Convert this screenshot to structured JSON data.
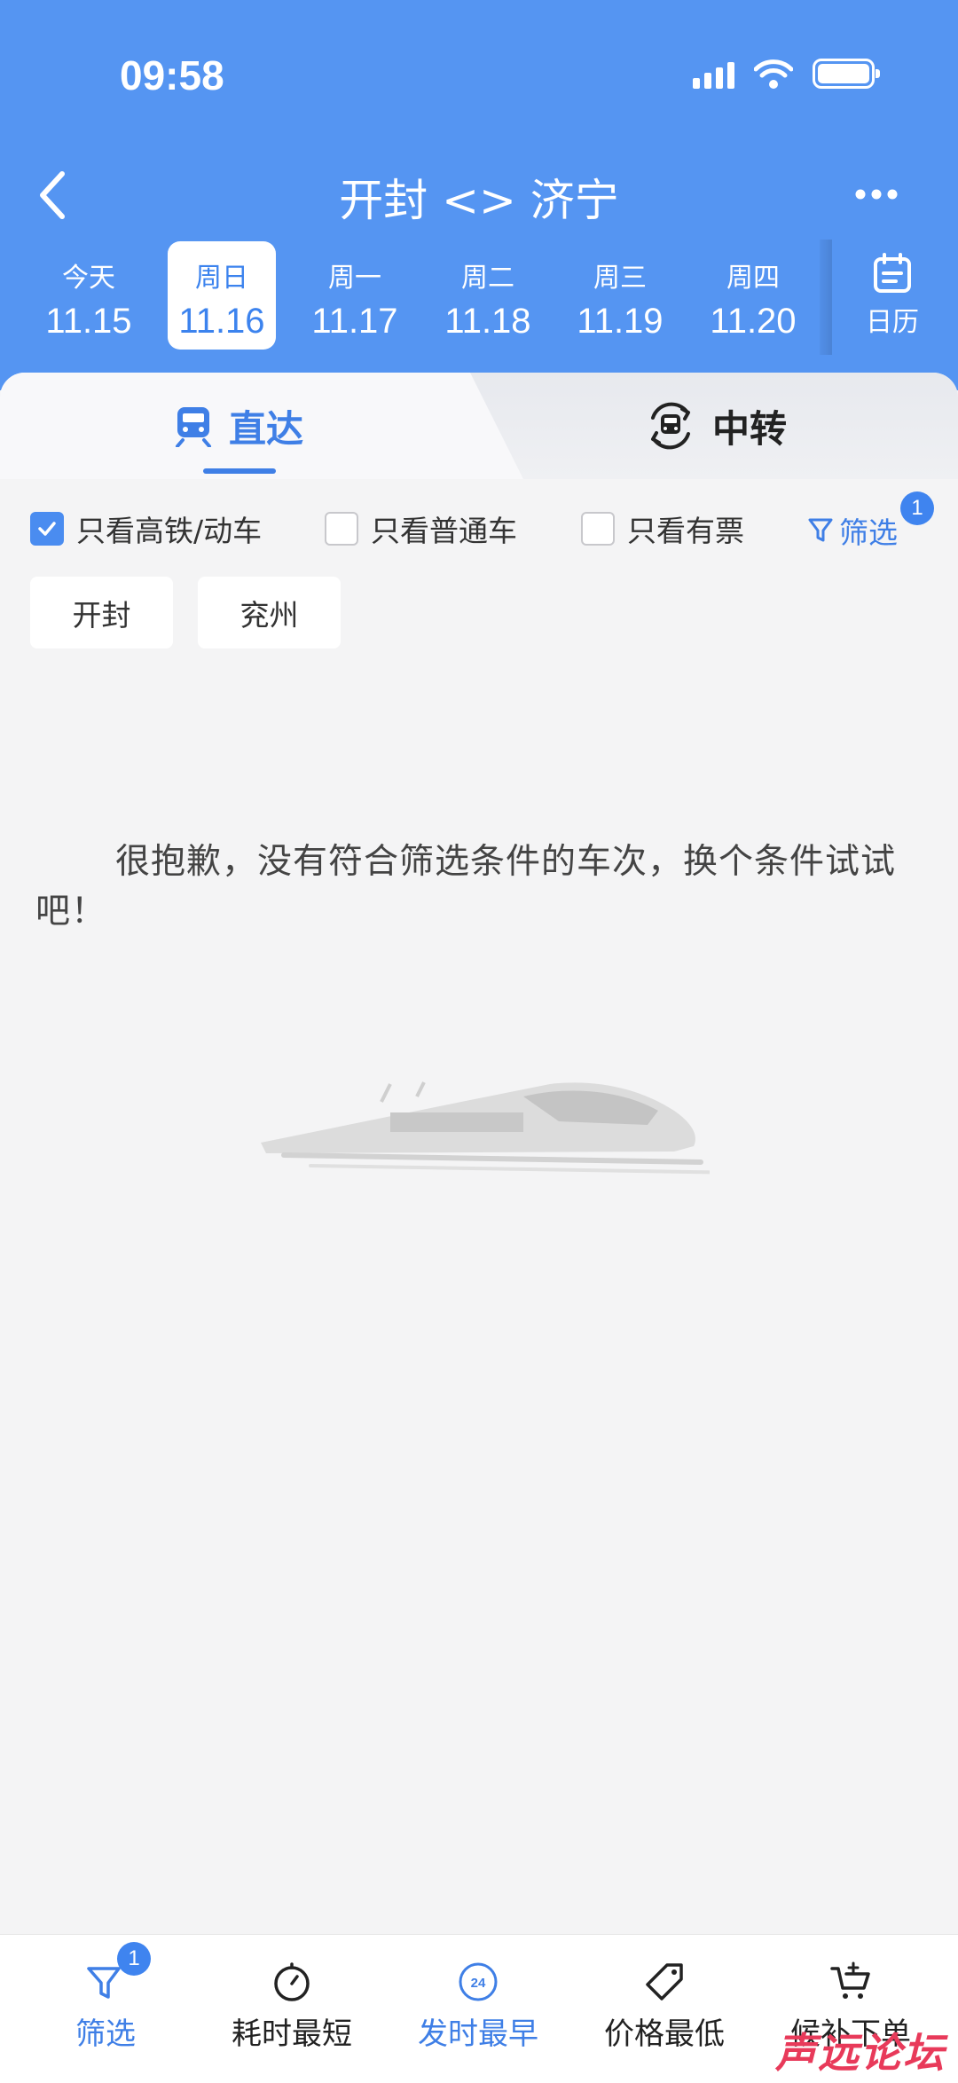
{
  "status_bar": {
    "time": "09:58"
  },
  "nav": {
    "title": "开封 <> 济宁"
  },
  "dates": [
    {
      "weekday": "今天",
      "date": "11.15"
    },
    {
      "weekday": "周日",
      "date": "11.16",
      "active": true
    },
    {
      "weekday": "周一",
      "date": "11.17"
    },
    {
      "weekday": "周二",
      "date": "11.18"
    },
    {
      "weekday": "周三",
      "date": "11.19"
    },
    {
      "weekday": "周四",
      "date": "11.20"
    }
  ],
  "calendar": {
    "label": "日历"
  },
  "tabs": {
    "direct": "直达",
    "transfer": "中转"
  },
  "filters": {
    "high_speed": {
      "label": "只看高铁/动车",
      "checked": true
    },
    "normal": {
      "label": "只看普通车",
      "checked": false
    },
    "available": {
      "label": "只看有票",
      "checked": false
    },
    "filter_link": "筛选",
    "filter_badge": "1"
  },
  "stations": [
    "开封",
    "兖州"
  ],
  "empty": {
    "message": "很抱歉，没有符合筛选条件的车次，换个条件试试吧！"
  },
  "bottom_bar": {
    "filter": "筛选",
    "filter_badge": "1",
    "shortest": "耗时最短",
    "earliest": "发时最早",
    "earliest_icon_text": "24",
    "cheapest": "价格最低",
    "waitlist": "候补下单"
  },
  "watermark": "声远论坛",
  "colors": {
    "primary": "#5595f2",
    "accent": "#3f7fe6",
    "background": "#f4f4f5"
  }
}
